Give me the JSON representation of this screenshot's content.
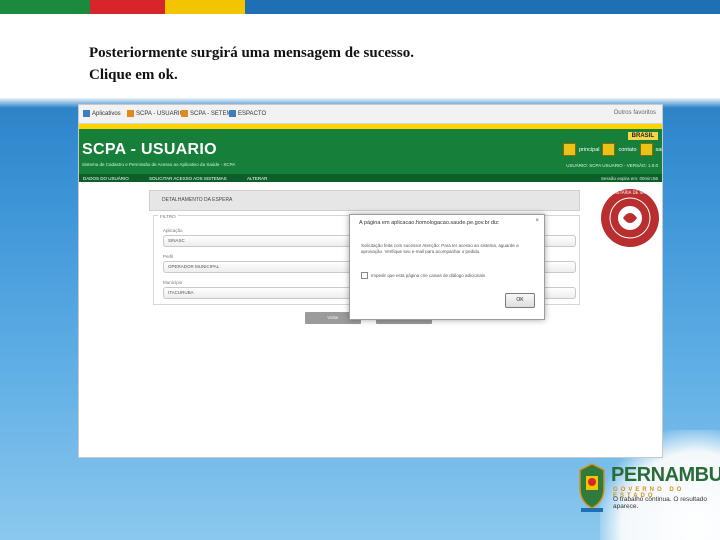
{
  "slide": {
    "line1": "Posteriormente surgirá uma mensagem de sucesso.",
    "line2": "Clique em ok.",
    "stripe_colors": [
      "#1b8a3c",
      "#d8252b",
      "#f2c500",
      "#1f6fb5"
    ]
  },
  "browser": {
    "bookmarks": [
      {
        "label": "Aplicativos",
        "icon": "apps-icon"
      },
      {
        "label": "SCPA - USUARIO",
        "icon": "page-icon"
      },
      {
        "label": "SCPA - SETEMA",
        "icon": "page-icon"
      },
      {
        "label": "ESPACTO",
        "icon": "page-icon"
      }
    ],
    "other_bookmarks": "Outros favoritos"
  },
  "app": {
    "title": "SCPA - USUARIO",
    "subtitle": "Sistema de Cadastro e Permissão de Acesso ao Aplicativo da Saúde - SCPA",
    "brasil": "BRASIL",
    "header_buttons": [
      {
        "label": "principal",
        "icon": "home-icon"
      },
      {
        "label": "contato",
        "icon": "mail-icon"
      },
      {
        "label": "sair",
        "icon": "close-icon"
      }
    ],
    "user_info": "USUÁRIO: SCPA USUARIO - VERSÃO: 1.0.0",
    "nav": [
      "DADOS DO USUÁRIO",
      "SOLICITAR ACESSO AOS SISTEMAS",
      "ALTERAR"
    ],
    "session_status": "Sessão expira em: 00min:56",
    "tab": "DETALHAMENTO DA ESPERA",
    "filter_legend": "FILTRO",
    "fields": [
      {
        "label": "Aplicação",
        "value": "SINASC"
      },
      {
        "label": "Perfil",
        "value": "OPERADOR MUNICIPAL"
      },
      {
        "label": "Município",
        "value": "ITACURUBA"
      }
    ],
    "buttons": [
      "Voltar",
      "Enviar"
    ],
    "seal_text": "SECRETARIA DE SAÚDE"
  },
  "dialog": {
    "title": "A página em aplicacao.homologacao.saude.pe.gov.br diz:",
    "close": "×",
    "message": "Solicitação feita com sucesso! Atenção: Para ter acesso ao sistema, aguarde a aprovação. Verifique seu e-mail para acompanhar o pedido.",
    "checkbox": "Impedir que esta página crie caixas de diálogo adicionais",
    "ok": "OK"
  },
  "logo": {
    "brand": "PERNAMBUCO",
    "government": "GOVERNO DO ESTADO",
    "slogan": "O trabalho continua. O resultado aparece."
  }
}
